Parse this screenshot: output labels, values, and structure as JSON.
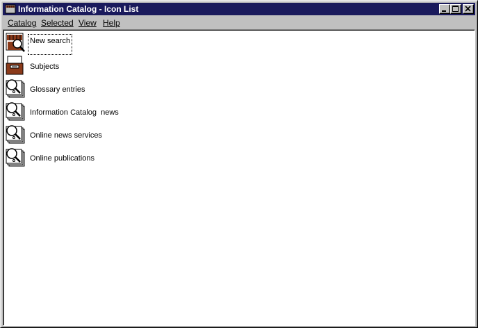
{
  "window": {
    "title": "Information Catalog - Icon List",
    "title_icon": "catalog-icon",
    "controls": [
      "minimize-icon",
      "maximize-icon",
      "close-icon"
    ]
  },
  "menu": {
    "items": [
      {
        "label": "Catalog"
      },
      {
        "label": "Selected"
      },
      {
        "label": "View"
      },
      {
        "label": "Help"
      }
    ]
  },
  "list": {
    "items": [
      {
        "label": "New search",
        "icon": "new-search-icon",
        "focused": true
      },
      {
        "label": "Subjects",
        "icon": "subjects-drawer-icon"
      },
      {
        "label": "Glossary entries",
        "icon": "magnifier-documents-icon"
      },
      {
        "label": "Information Catalog  news",
        "icon": "magnifier-documents-icon"
      },
      {
        "label": "Online news services",
        "icon": "magnifier-documents-icon"
      },
      {
        "label": "Online publications",
        "icon": "magnifier-documents-icon"
      }
    ]
  },
  "colors": {
    "titlebar": "#1a1a5c",
    "face": "#c0c0c0",
    "content_bg": "#ffffff",
    "icon_brown": "#8b3a1a"
  }
}
